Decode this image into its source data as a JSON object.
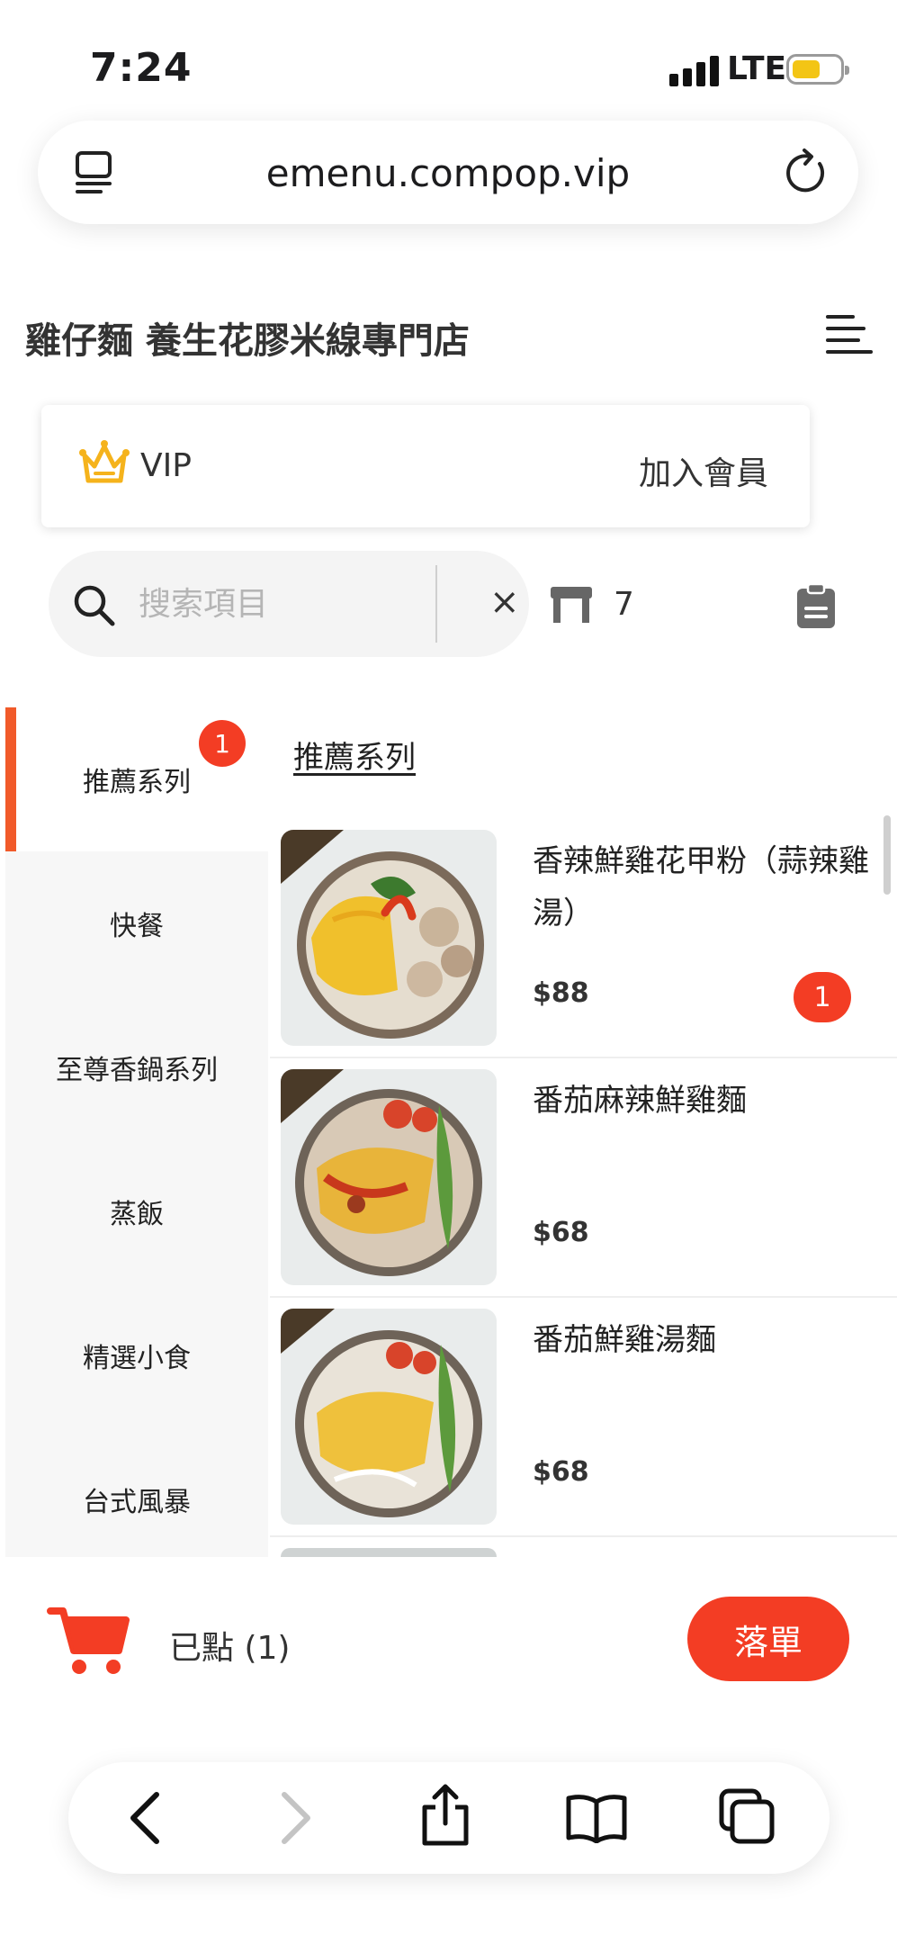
{
  "status_bar": {
    "time": "7:24",
    "network": "LTE",
    "battery_level": 0.5,
    "battery_color": "#f3c515"
  },
  "browser": {
    "url": "emenu.compop.vip"
  },
  "header": {
    "store_name": "雞仔麵 養生花膠米線專門店"
  },
  "vip": {
    "label": "VIP",
    "join_label": "加入會員"
  },
  "search": {
    "placeholder": "搜索項目",
    "value": "",
    "clear_label": "×"
  },
  "table": {
    "number": "7"
  },
  "sidebar": {
    "badge": "1",
    "categories": [
      {
        "label": "推薦系列",
        "active": true
      },
      {
        "label": "快餐"
      },
      {
        "label": "至尊香鍋系列"
      },
      {
        "label": "蒸飯"
      },
      {
        "label": "精選小食"
      },
      {
        "label": "台式風暴"
      }
    ]
  },
  "section": {
    "title": "推薦系列"
  },
  "items": [
    {
      "name": "香辣鮮雞花甲粉（蒜辣雞湯）",
      "price": "$88",
      "qty": "1"
    },
    {
      "name": "番茄麻辣鮮雞麵",
      "price": "$68"
    },
    {
      "name": "番茄鮮雞湯麵",
      "price": "$68"
    }
  ],
  "cart": {
    "summary": "已點 (1)",
    "order_label": "落單"
  },
  "colors": {
    "accent": "#f33d24",
    "sidebar_bg": "#f7f7f7",
    "crown": "#f5b31c"
  }
}
